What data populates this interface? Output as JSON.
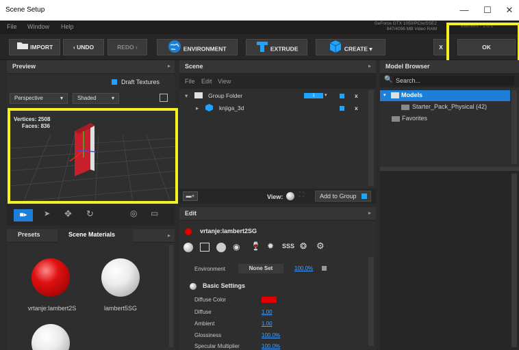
{
  "window": {
    "title": "Scene Setup",
    "minimize": "—",
    "maximize": "☐",
    "close": "✕"
  },
  "menubar": {
    "items": [
      "File",
      "Window",
      "Help"
    ],
    "gpu_line1": "GeForce GTX 1050/PCIe/SSE2",
    "gpu_line2": "847/4096 MB Video RAM",
    "right_hint": "Element · 1.0.0"
  },
  "toolbar": {
    "import": "IMPORT",
    "undo": "UNDO",
    "redo": "REDO",
    "environment": "ENVIRONMENT",
    "extrude": "EXTRUDE",
    "create": "CREATE",
    "close_x": "X",
    "ok": "OK"
  },
  "preview": {
    "title": "Preview",
    "draft_textures": "Draft Textures",
    "perspective": "Perspective",
    "shaded": "Shaded",
    "vertices_label": "Vertices:",
    "vertices_value": "2508",
    "faces_label": "Faces:",
    "faces_value": "836"
  },
  "scene": {
    "title": "Scene",
    "menu": [
      "File",
      "Edit",
      "View"
    ],
    "group_folder": "Group Folder",
    "group_badge": "1",
    "child": "knjiga_3d",
    "view_label": "View:",
    "add_to_group": "Add to Group"
  },
  "model_browser": {
    "title": "Model Browser",
    "search_placeholder": "Search...",
    "models": "Models",
    "starter_pack": "Starter_Pack_Physical (42)",
    "favorites": "Favorites"
  },
  "presets": {
    "tab_presets": "Presets",
    "tab_scene_materials": "Scene Materials",
    "materials": [
      {
        "name": "vrtanje:lambert2S",
        "color": "#e01010"
      },
      {
        "name": "lambert5SG",
        "color": "#f2f2f2"
      },
      {
        "name": "",
        "color": "#f2f2f2"
      }
    ]
  },
  "edit": {
    "title": "Edit",
    "material_name": "vrtanje:lambert2SG",
    "env_label": "Environment",
    "env_value": "None Set",
    "env_pct": "100.0%",
    "section": "Basic Settings",
    "rows": [
      {
        "label": "Diffuse Color",
        "value": "",
        "swatch": "#e00000"
      },
      {
        "label": "Diffuse",
        "value": "1.00"
      },
      {
        "label": "Ambient",
        "value": "1.00"
      },
      {
        "label": "Glossiness",
        "value": "100.0%"
      },
      {
        "label": "Specular Multiplier",
        "value": "100.0%"
      }
    ],
    "sss_label": "SSS"
  },
  "colors": {
    "accent": "#1ea3ff",
    "highlight": "#f4f023",
    "material_red": "#e00000"
  }
}
